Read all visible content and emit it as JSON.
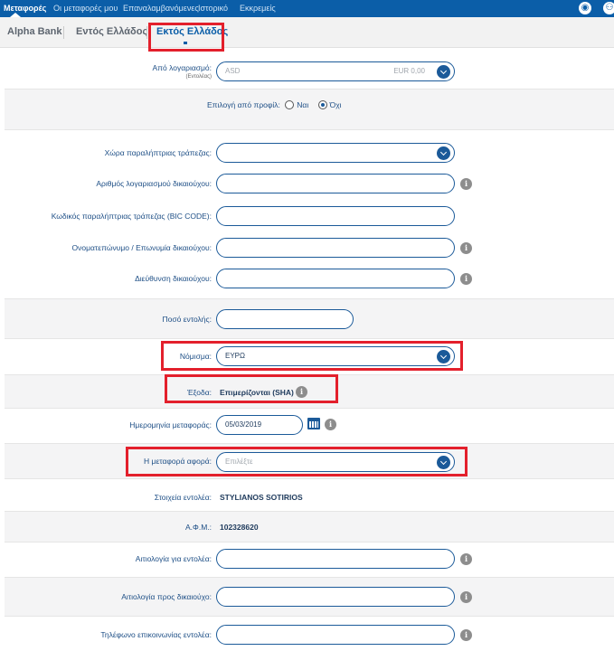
{
  "nav": {
    "items": [
      "Μεταφορές",
      "Οι μεταφορές μου",
      "Επαναλαμβανόμενες",
      "Ιστορικό",
      "Εκκρεμείς"
    ],
    "icons": [
      "eye-icon",
      "account-icon"
    ]
  },
  "subtabs": [
    "Alpha Bank",
    "Εντός Ελλάδος",
    "Εκτός Ελλάδος"
  ],
  "form": {
    "from_account": {
      "label": "Από λογαριασμό:",
      "sublabel": "(Εντολέας)",
      "account": "ASD",
      "balance": "EUR 0,00"
    },
    "profile": {
      "label": "Επιλογή από προφίλ:",
      "yes": "Ναι",
      "no": "Όχι",
      "selected": "Όχι"
    },
    "bank_country": {
      "label": "Χώρα παραλήπτριας τράπεζας:"
    },
    "beneficiary_account": {
      "label": "Αριθμός λογαριασμού δικαιούχου:"
    },
    "bic_code": {
      "label": "Κωδικός παραλήπτριας τράπεζας (BIC CODE):"
    },
    "beneficiary_name": {
      "label": "Ονοματεπώνυμο / Επωνυμία δικαιούχου:"
    },
    "beneficiary_address": {
      "label": "Διεύθυνση δικαιούχου:"
    },
    "amount": {
      "label": "Ποσό εντολής:"
    },
    "currency": {
      "label": "Νόμισμα:",
      "value": "ΕΥΡΩ"
    },
    "charges": {
      "label": "Έξοδα:",
      "value": "Επιμερίζονται (SHA)"
    },
    "transfer_date": {
      "label": "Ημερομηνία μεταφοράς:",
      "value": "05/03/2019"
    },
    "transfer_purpose": {
      "label": "Η μεταφορά αφορά:",
      "placeholder": "Επιλέξτε"
    },
    "orderer": {
      "label": "Στοιχεία εντολέα:",
      "value": "STYLIANOS SOTIRIOS"
    },
    "tax_id": {
      "label": "Α.Φ.Μ.:",
      "value": "102328620"
    },
    "reason_orderer": {
      "label": "Αιτιολογία για εντολέα:"
    },
    "reason_beneficiary": {
      "label": "Αιτιολογία προς δικαιούχο:"
    },
    "orderer_phone": {
      "label": "Τηλέφωνο επικοινωνίας εντολέα:"
    }
  },
  "colors": {
    "brand": "#0b5ea8",
    "highlight": "#e3202c"
  }
}
